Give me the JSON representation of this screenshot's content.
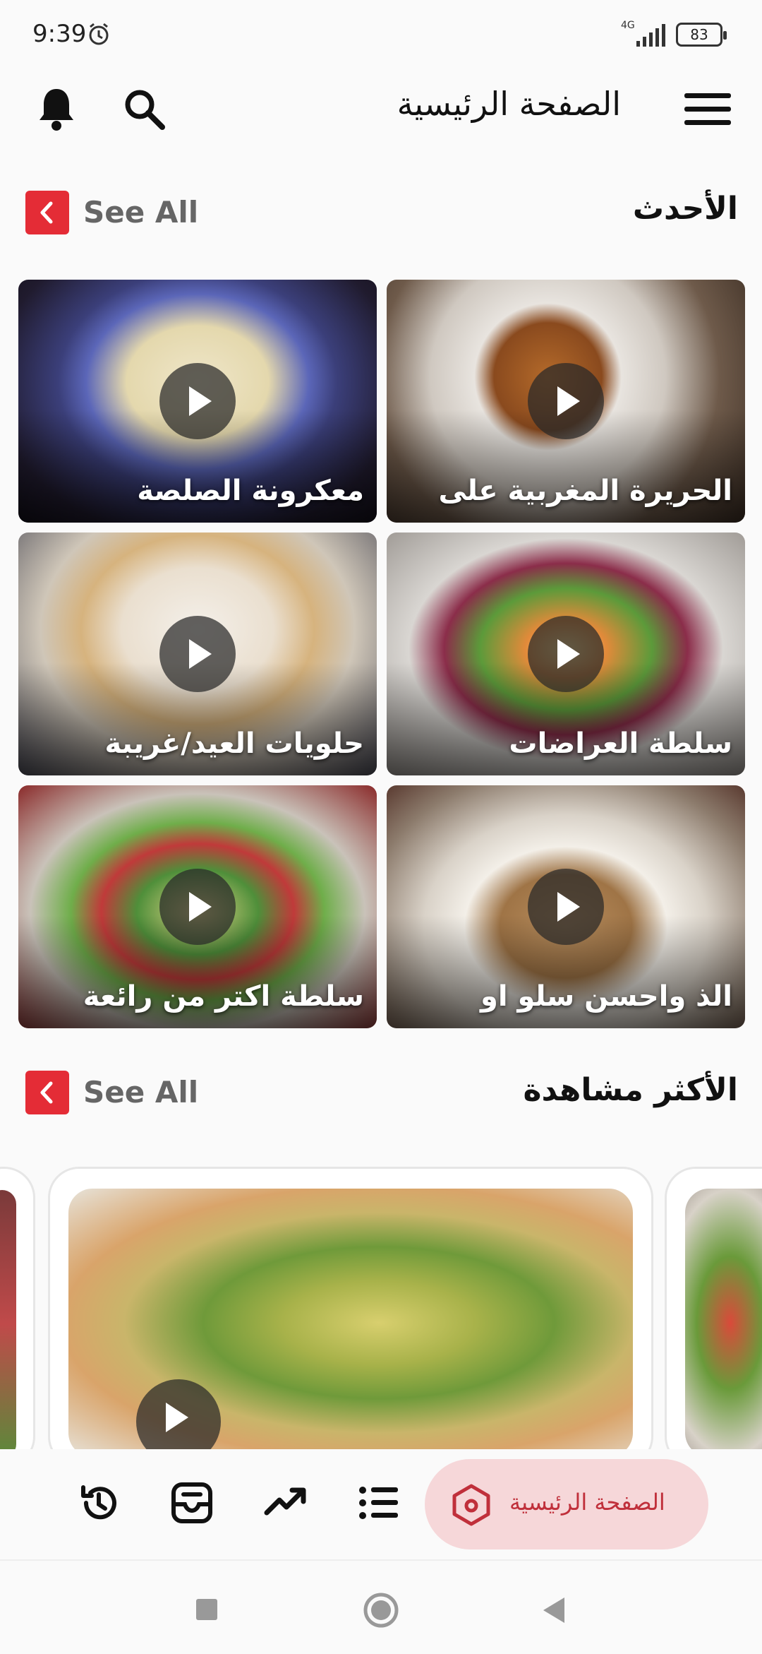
{
  "status_bar": {
    "time": "9:39",
    "network": "4G",
    "battery": "83"
  },
  "header": {
    "title": "الصفحة الرئيسية"
  },
  "latest": {
    "title": "الأحدث",
    "see_all": "See All",
    "items": [
      {
        "caption": "الحريرة المغربية على"
      },
      {
        "caption": "معكرونة الصلصة"
      },
      {
        "caption": "سلطة العراضات"
      },
      {
        "caption": "حلويات العيد/غريبة"
      },
      {
        "caption": "الذ واحسن سلو او"
      },
      {
        "caption": "سلطة اكتر من رائعة"
      }
    ]
  },
  "most_viewed": {
    "title": "الأكثر مشاهدة",
    "see_all": "See All"
  },
  "bottom_nav": {
    "home_label": "الصفحة الرئيسية"
  },
  "colors": {
    "accent": "#e42c36",
    "home_pill": "#f6d7d9",
    "home_text": "#c0303b"
  }
}
